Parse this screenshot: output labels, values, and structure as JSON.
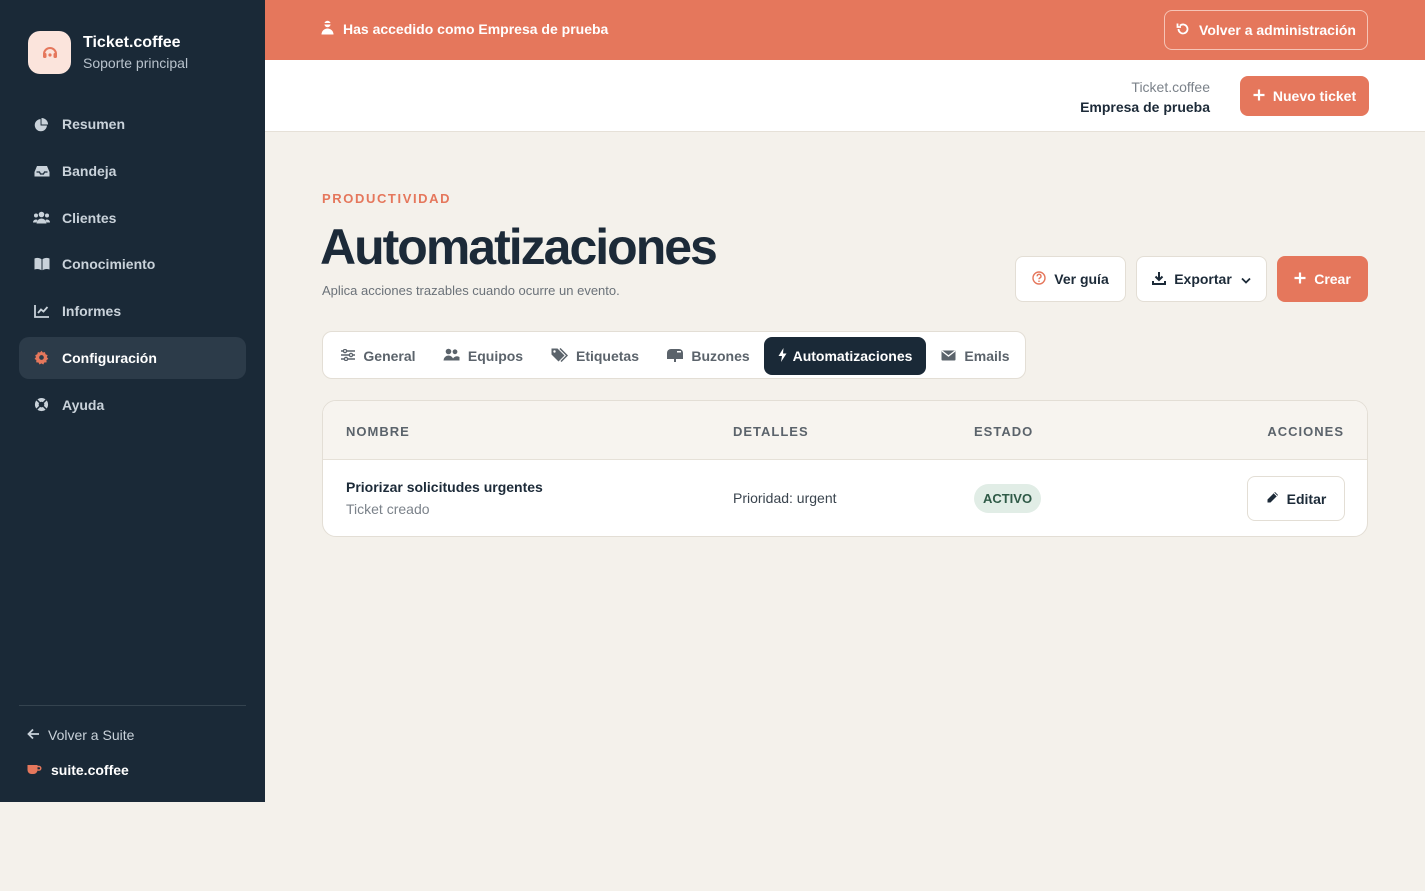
{
  "sidebar": {
    "brand_name": "Ticket.coffee",
    "brand_sub": "Soporte principal",
    "items": [
      {
        "label": "Resumen",
        "icon": "chart-pie-icon"
      },
      {
        "label": "Bandeja",
        "icon": "inbox-icon"
      },
      {
        "label": "Clientes",
        "icon": "users-icon"
      },
      {
        "label": "Conocimiento",
        "icon": "book-icon"
      },
      {
        "label": "Informes",
        "icon": "chart-line-icon"
      },
      {
        "label": "Configuración",
        "icon": "gear-icon",
        "active": true
      },
      {
        "label": "Ayuda",
        "icon": "life-ring-icon"
      }
    ],
    "back_label": "Volver a Suite",
    "suite_label": "suite.coffee"
  },
  "banner": {
    "message": "Has accedido como Empresa de prueba",
    "button_label": "Volver a administración"
  },
  "topbar": {
    "product": "Ticket.coffee",
    "company": "Empresa de prueba",
    "new_ticket_label": "Nuevo ticket"
  },
  "page": {
    "eyebrow": "PRODUCTIVIDAD",
    "title": "Automatizaciones",
    "subtitle": "Aplica acciones trazables cuando ocurre un evento.",
    "guide_label": "Ver guía",
    "export_label": "Exportar",
    "create_label": "Crear"
  },
  "tabs": [
    {
      "label": "General",
      "icon": "sliders-icon"
    },
    {
      "label": "Equipos",
      "icon": "users-icon"
    },
    {
      "label": "Etiquetas",
      "icon": "tags-icon"
    },
    {
      "label": "Buzones",
      "icon": "mailbox-icon"
    },
    {
      "label": "Automatizaciones",
      "icon": "bolt-icon",
      "active": true
    },
    {
      "label": "Emails",
      "icon": "envelope-icon"
    }
  ],
  "table": {
    "columns": [
      "NOMBRE",
      "DETALLES",
      "ESTADO",
      "ACCIONES"
    ],
    "rows": [
      {
        "name": "Priorizar solicitudes urgentes",
        "trigger": "Ticket creado",
        "details": "Prioridad: urgent",
        "status": "ACTIVO",
        "action_label": "Editar"
      }
    ]
  },
  "colors": {
    "accent": "#e5775c",
    "sidebar": "#1a2937",
    "background": "#f4f1eb",
    "status_active_bg": "#e1ede6"
  }
}
